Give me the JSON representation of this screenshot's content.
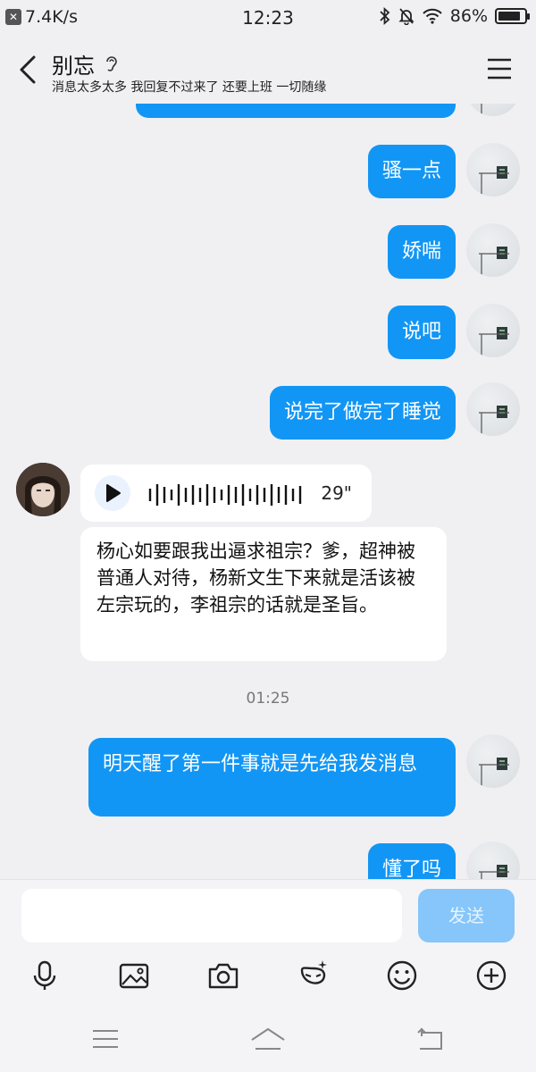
{
  "status": {
    "speed": "7.4K/s",
    "time": "12:23",
    "battery": "86%",
    "battery_level": 0.86
  },
  "header": {
    "title": "别忘",
    "subtitle": "消息太多太多 我回复不过来了 还要上班 一切随缘"
  },
  "messages": [
    {
      "from": "me",
      "text": "骚一点"
    },
    {
      "from": "me",
      "text": "娇喘"
    },
    {
      "from": "me",
      "text": "说吧"
    },
    {
      "from": "me",
      "text": "说完了做完了睡觉"
    },
    {
      "from": "them",
      "type": "voice",
      "duration": "29\""
    },
    {
      "from": "them",
      "text": "杨心如要跟我出逼求祖宗？爹，超神被普通人对待，杨新文生下来就是活该被左宗玩的，李祖宗的话就是圣旨。"
    },
    {
      "type": "time",
      "text": "01:25"
    },
    {
      "from": "me",
      "text": "明天醒了第一件事就是先给我发消息"
    },
    {
      "from": "me",
      "text": "懂了吗"
    }
  ],
  "input": {
    "value": "",
    "send_label": "发送"
  },
  "toolbar": {
    "items": [
      "mic-icon",
      "image-icon",
      "camera-icon",
      "sticker-icon",
      "emoji-icon",
      "plus-icon"
    ]
  },
  "colors": {
    "accent": "#1296f5",
    "send_disabled": "#86c6fa",
    "background": "#f0f0f3"
  }
}
